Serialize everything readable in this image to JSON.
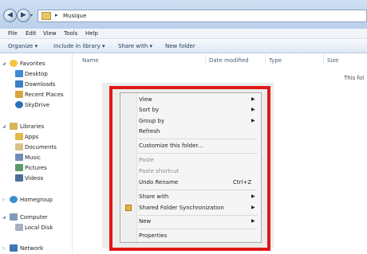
{
  "window": {
    "address": {
      "folder": "Musique"
    }
  },
  "menubar": [
    "File",
    "Edit",
    "View",
    "Tools",
    "Help"
  ],
  "toolbar": {
    "organize": "Organize ▾",
    "include_in_library": "Include in library ▾",
    "share_with": "Share with ▾",
    "new_folder": "New folder"
  },
  "columns": [
    "Name",
    "Date modified",
    "Type",
    "Size"
  ],
  "content": {
    "empty_message": "This fol"
  },
  "nav": {
    "favorites": {
      "label": "Favorites",
      "items": [
        "Desktop",
        "Downloads",
        "Recent Places",
        "SkyDrive"
      ]
    },
    "libraries": {
      "label": "Libraries",
      "items": [
        "Apps",
        "Documents",
        "Music",
        "Pictures",
        "Videos"
      ]
    },
    "homegroup": "Homegroup",
    "computer": {
      "label": "Computer",
      "items": [
        "Local Disk"
      ]
    },
    "network": "Network"
  },
  "context_menu": {
    "items": [
      {
        "label": "View",
        "submenu": true
      },
      {
        "label": "Sort by",
        "submenu": true
      },
      {
        "label": "Group by",
        "submenu": true
      },
      {
        "label": "Refresh"
      },
      {
        "label": "Customize this folder..."
      },
      {
        "label": "Paste",
        "disabled": true
      },
      {
        "label": "Paste shortcut",
        "disabled": true
      },
      {
        "label": "Undo Rename",
        "shortcut": "Ctrl+Z"
      },
      {
        "label": "Share with",
        "submenu": true
      },
      {
        "label": "Shared Folder Synchronization",
        "submenu": true,
        "icon": "sync-folder-icon"
      },
      {
        "label": "New",
        "submenu": true
      },
      {
        "label": "Properties"
      }
    ]
  },
  "colors": {
    "highlight": "#e01818",
    "titlebar": "#c4d8ee"
  }
}
